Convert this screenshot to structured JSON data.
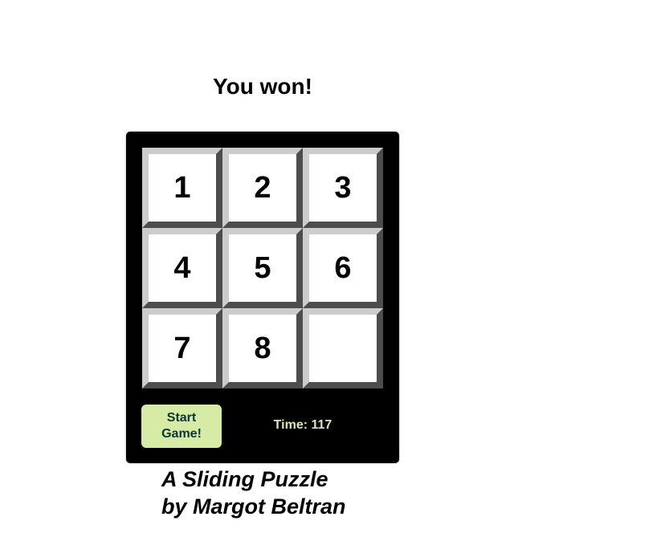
{
  "header": {
    "title": "You won!"
  },
  "board": {
    "tiles": [
      "1",
      "2",
      "3",
      "4",
      "5",
      "6",
      "7",
      "8",
      ""
    ]
  },
  "controls": {
    "start_label": "Start Game!",
    "time_label": "Time: 117"
  },
  "footer": {
    "line1": "A Sliding Puzzle",
    "line2": "by Margot Beltran"
  },
  "colors": {
    "tile_light": "#cccccc",
    "tile_dark": "#4d4d4d",
    "button_bg": "#d6eca6",
    "button_text": "#0b3535",
    "time_text": "#d6eca6"
  }
}
